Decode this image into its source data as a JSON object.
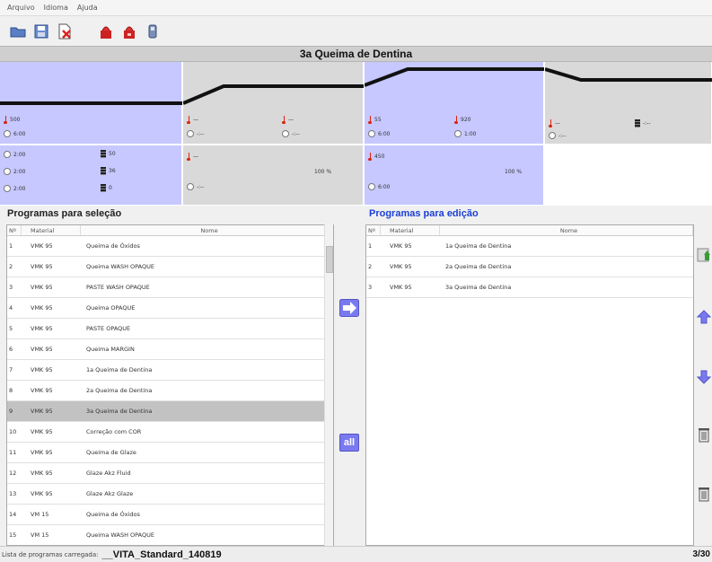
{
  "menu": [
    "Arquivo",
    "Idioma",
    "Ajuda"
  ],
  "toolbar": {
    "icons": [
      "folder-open-icon",
      "save-icon",
      "delete-file-icon",
      "furnace-red-icon",
      "furnace-red-2-icon",
      "device-icon"
    ]
  },
  "title": "3a Queima de Dentina",
  "program_panel": {
    "r1c1": {
      "temp": "500",
      "time": "6:00"
    },
    "r1c2": {
      "temp_a": "—",
      "temp_b": "—",
      "time_a": "-:--",
      "time_b": "-:--"
    },
    "r1c3": {
      "temp_a": "55",
      "temp_b": "920",
      "time_a": "6:00",
      "time_b": "1:00"
    },
    "r1c4": {
      "temp": "—",
      "time": "-:--",
      "vac": "-:--"
    },
    "r2c1": {
      "times": [
        "2:00",
        "2:00",
        "2:00"
      ],
      "vac": [
        "50",
        "36",
        "0"
      ]
    },
    "r2c2": {
      "temp": "—",
      "time": "-:--",
      "pct": "100 %"
    },
    "r2c3": {
      "temp": "450",
      "time": "6:00",
      "pct": "100 %"
    }
  },
  "left": {
    "heading": "Programas para seleção",
    "columns": [
      "Nº",
      "Material",
      "Nome"
    ],
    "rows": [
      [
        "1",
        "VMK 95",
        "Queima de Óxidos"
      ],
      [
        "2",
        "VMK 95",
        "Queima WASH OPAQUE"
      ],
      [
        "3",
        "VMK 95",
        "PASTE WASH OPAQUE"
      ],
      [
        "4",
        "VMK 95",
        "Queima OPAQUE"
      ],
      [
        "5",
        "VMK 95",
        "PASTE OPAQUE"
      ],
      [
        "6",
        "VMK 95",
        "Queima MARGIN"
      ],
      [
        "7",
        "VMK 95",
        "1a Queima de Dentina"
      ],
      [
        "8",
        "VMK 95",
        "2a Queima de Dentina"
      ],
      [
        "9",
        "VMK 95",
        "3a Queima de Dentina"
      ],
      [
        "10",
        "VMK 95",
        "Correção com COR"
      ],
      [
        "11",
        "VMK 95",
        "Queima de Glaze"
      ],
      [
        "12",
        "VMK 95",
        "Glaze Akz Fluid"
      ],
      [
        "13",
        "VMK 95",
        "Glaze Akz Glaze"
      ],
      [
        "14",
        "VM 15",
        "Queima de Óxidos"
      ],
      [
        "15",
        "VM 15",
        "Queima WASH OPAQUE"
      ]
    ],
    "selected_index": 8
  },
  "middle": {
    "all_label": "all"
  },
  "right": {
    "heading": "Programas para edição",
    "columns": [
      "Nº",
      "Material",
      "Nome"
    ],
    "rows": [
      [
        "1",
        "VMK 95",
        "1a Queima de Dentina"
      ],
      [
        "2",
        "VMK 95",
        "2a Queima de Dentina"
      ],
      [
        "3",
        "VMK 95",
        "3a Queima de Dentina"
      ]
    ]
  },
  "status": {
    "label": "Lista de programas carregada:",
    "program": "__VITA_Standard_140819",
    "count": "3/30"
  }
}
